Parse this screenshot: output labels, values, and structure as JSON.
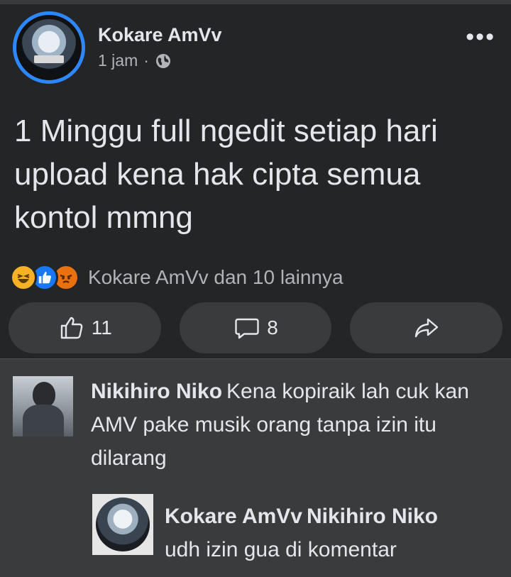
{
  "post": {
    "author": "Kokare AmVv",
    "time": "1 jam",
    "separator": "·",
    "text": "1 Minggu full ngedit setiap hari upload kena hak cipta semua kontol mmng",
    "reactions_text": "Kokare AmVv dan 10 lainnya",
    "reactions": [
      "haha-icon",
      "like-icon",
      "angry-icon"
    ]
  },
  "actions": {
    "like_count": "11",
    "comment_count": "8"
  },
  "comments": [
    {
      "author": "Nikihiro Niko",
      "text": "Kena kopiraik lah cuk kan AMV pake musik orang tanpa izin itu dilarang"
    },
    {
      "author": "Kokare AmVv",
      "mention": "Nikihiro Niko",
      "text": "udh izin gua di komentar"
    }
  ],
  "colors": {
    "background": "#242526",
    "comment_bg": "#3a3b3c",
    "accent": "#2d88ff",
    "secondary_text": "#b0b3b8"
  }
}
